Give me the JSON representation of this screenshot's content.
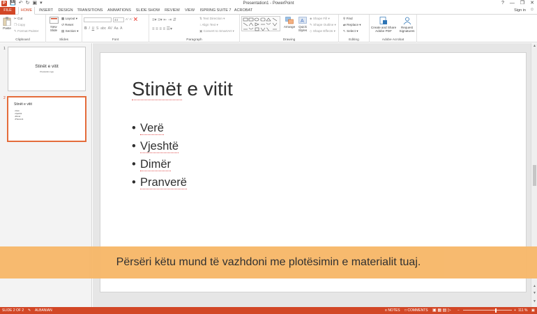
{
  "window": {
    "title": "Presentation1 - PowerPoint",
    "sign_in": "Sign in",
    "controls": [
      "?",
      "—",
      "❐",
      "✕"
    ]
  },
  "tabs": [
    "FILE",
    "HOME",
    "INSERT",
    "DESIGN",
    "TRANSITIONS",
    "ANIMATIONS",
    "SLIDE SHOW",
    "REVIEW",
    "VIEW",
    "ISPRING SUITE 7",
    "ACROBAT"
  ],
  "ribbon": {
    "clipboard": {
      "label": "Clipboard",
      "paste": "Paste",
      "cut": "Cut",
      "copy": "Copy",
      "format_painter": "Format Painter"
    },
    "slides": {
      "label": "Slides",
      "new_slide_1": "New",
      "new_slide_2": "Slide",
      "layout": "Layout",
      "reset": "Reset",
      "section": "Section"
    },
    "font": {
      "label": "Font",
      "size": "44"
    },
    "paragraph": {
      "label": "Paragraph",
      "text_direction": "Text Direction",
      "align_text": "Align Text",
      "convert_smartart": "Convert to SmartArt"
    },
    "drawing": {
      "label": "Drawing",
      "arrange": "Arrange",
      "quick_styles_1": "Quick",
      "quick_styles_2": "Styles",
      "shape_fill": "Shape Fill",
      "shape_outline": "Shape Outline",
      "shape_effects": "Shape Effects"
    },
    "editing": {
      "label": "Editing",
      "find": "Find",
      "replace": "Replace",
      "select": "Select"
    },
    "acrobat": {
      "label": "Adobe Acrobat",
      "create_share_1": "Create and Share",
      "create_share_2": "Adobe PDF",
      "request_sig_1": "Request",
      "request_sig_2": "Signatures"
    }
  },
  "thumbnails": [
    {
      "number": "1",
      "title": "Stinët e vitit",
      "subtitle": "Prezantim nga"
    },
    {
      "number": "2",
      "title": "Stinët e vitit",
      "bullets": [
        "Verë",
        "Vjeshtë",
        "Dimër",
        "Pranverë"
      ]
    }
  ],
  "slide": {
    "title_word1": "Stinët",
    "title_rest": " e vitit",
    "bullets": [
      "Verë",
      "Vjeshtë",
      "Dimër",
      "Pranverë"
    ]
  },
  "banner": {
    "text": "Përsëri këtu mund të vazhdoni me plotësimin e materialit tuaj."
  },
  "status": {
    "slide_of": "SLIDE 2 OF 2",
    "language": "ALBANIAN",
    "notes": "NOTES",
    "comments": "COMMENTS",
    "zoom": "111 %"
  },
  "colors": {
    "accent": "#d24726",
    "banner": "#f7b86a",
    "selection": "#e46c3a"
  }
}
